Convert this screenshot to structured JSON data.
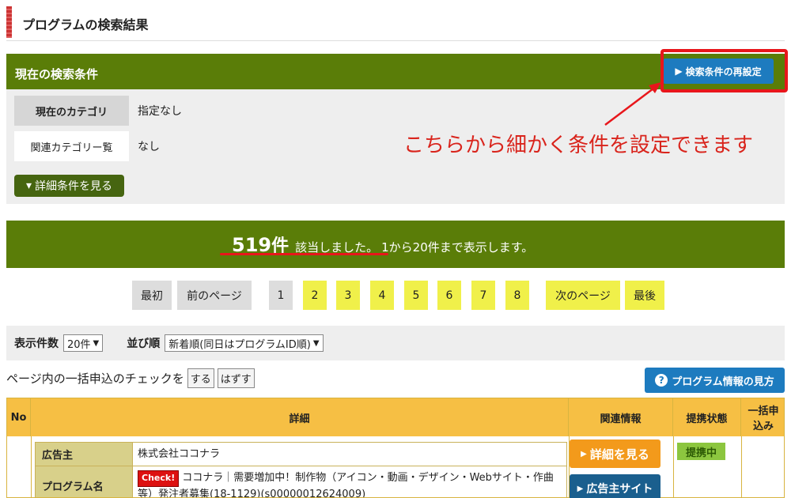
{
  "page_title": "プログラムの検索結果",
  "conditions": {
    "header": "現在の検索条件",
    "reset_button": "検索条件の再設定",
    "rows": [
      {
        "label": "現在のカテゴリ",
        "value": "指定なし"
      },
      {
        "label": "関連カテゴリー覧",
        "value": "なし"
      }
    ],
    "detail_button": "詳細条件を見る"
  },
  "annotation": "こちらから細かく条件を設定できます",
  "result": {
    "count": "519",
    "unit": "件",
    "hit_text": "該当しました。",
    "range_text": "1から20件まで表示します。"
  },
  "pager": {
    "first": "最初",
    "prev": "前のページ",
    "pages": [
      "1",
      "2",
      "3",
      "4",
      "5",
      "6",
      "7",
      "8"
    ],
    "current_page": "1",
    "next": "次のページ",
    "last": "最後"
  },
  "sort": {
    "per_page_label": "表示件数",
    "per_page_value": "20件",
    "order_label": "並び順",
    "order_value": "新着順(同日はプログラムID順)"
  },
  "bulk": {
    "text": "ページ内の一括申込のチェックを",
    "do_button": "する",
    "undo_button": "はずす",
    "help_button": "プログラム情報の見方"
  },
  "table": {
    "headers": {
      "no": "No",
      "detail": "詳細",
      "related": "関連情報",
      "status": "提携状態",
      "bulk_apply": "一括申込み"
    },
    "row": {
      "advertiser_label": "広告主",
      "advertiser_value": "株式会社ココナラ",
      "program_label": "プログラム名",
      "check_badge": "Check!",
      "program_value": "ココナラ｜需要増加中！制作物（アイコン・動画・デザイン・Webサイト・作曲等）発注者募集(18-1129)(s00000012624009)",
      "detail_button": "詳細を見る",
      "site_button": "広告主サイト",
      "status": "提携中"
    }
  },
  "colors": {
    "green": "#5a7d08",
    "blue": "#1d7bbf",
    "red": "#e8161b",
    "yellow_page": "#f0f04a",
    "orange": "#f39a1b",
    "header_gold": "#f6bf44"
  }
}
